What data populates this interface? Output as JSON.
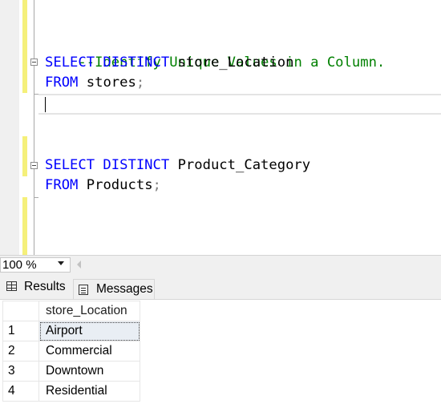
{
  "editor": {
    "lines": {
      "comment": "--Identify Unique Values in a Column.",
      "q1_select_kw": "SELECT DISTINCT",
      "q1_select_col": " store_Location",
      "q1_from_kw": "FROM",
      "q1_from_table": " stores",
      "q1_semicolon": ";",
      "q2_select_kw": "SELECT DISTINCT",
      "q2_select_col": " Product_Category",
      "q2_from_kw": "FROM",
      "q2_from_table": " Products",
      "q2_semicolon": ";"
    },
    "colors": {
      "keyword": "#0000ff",
      "comment": "#008000",
      "punctuation": "#808080",
      "change_bar": "#f5f07a"
    }
  },
  "zoom": {
    "value": "100 %"
  },
  "tabs": [
    {
      "label": "Results",
      "icon": "grid-icon",
      "active": true
    },
    {
      "label": "Messages",
      "icon": "messages-icon",
      "active": false
    }
  ],
  "results": {
    "columns": [
      "store_Location"
    ],
    "rows": [
      {
        "num": "1",
        "value": "Airport"
      },
      {
        "num": "2",
        "value": "Commercial"
      },
      {
        "num": "3",
        "value": "Downtown"
      },
      {
        "num": "4",
        "value": "Residential"
      }
    ]
  }
}
